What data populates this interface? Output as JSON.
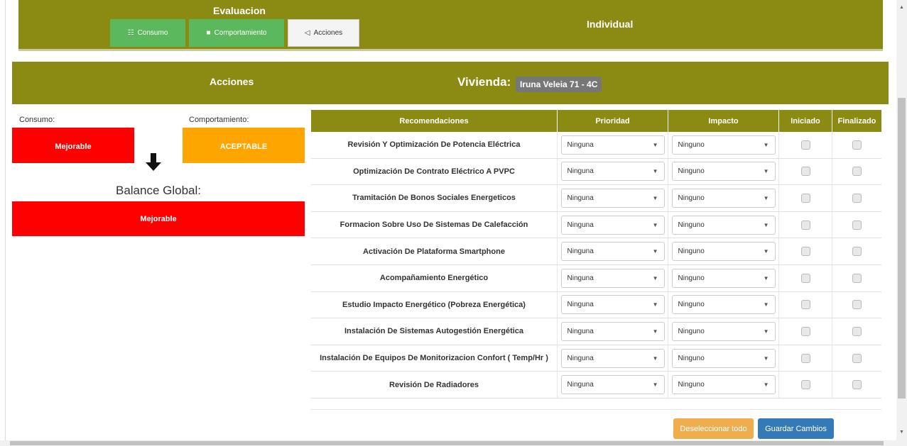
{
  "header": {
    "eval_title": "Evaluacion",
    "individual_title": "Individual",
    "tabs": [
      {
        "label": "Consumo",
        "icon": "chart-icon"
      },
      {
        "label": "Comportamiento",
        "icon": "book-icon"
      },
      {
        "label": "Acciones",
        "icon": "megaphone-icon"
      }
    ]
  },
  "acciones_bar": {
    "title": "Acciones",
    "vivienda_label": "Vivienda:",
    "vivienda_value": "Iruna Veleia 71 - 4C"
  },
  "left": {
    "consumo_label": "Consumo:",
    "consumo_value": "Mejorable",
    "comportamiento_label": "Comportamiento:",
    "comportamiento_value": "ACEPTABLE",
    "balance_title": "Balance Global:",
    "balance_value": "Mejorable"
  },
  "table": {
    "headers": [
      "Recomendaciones",
      "Prioridad",
      "Impacto",
      "Iniciado",
      "Finalizado"
    ],
    "rows": [
      {
        "name": "Revisión Y Optimización De Potencia Eléctrica",
        "prioridad": "Ninguna",
        "impacto": "Ninguno"
      },
      {
        "name": "Optimización De Contrato Eléctrico A PVPC",
        "prioridad": "Ninguna",
        "impacto": "Ninguno"
      },
      {
        "name": "Tramitación De Bonos Sociales Energeticos",
        "prioridad": "Ninguna",
        "impacto": "Ninguno"
      },
      {
        "name": "Formacion Sobre Uso De Sistemas De Calefacción",
        "prioridad": "Ninguna",
        "impacto": "Ninguno"
      },
      {
        "name": "Activación De Plataforma Smartphone",
        "prioridad": "Ninguna",
        "impacto": "Ninguno"
      },
      {
        "name": "Acompañamiento Energético",
        "prioridad": "Ninguna",
        "impacto": "Ninguno"
      },
      {
        "name": "Estudio Impacto Energético (Pobreza Energética)",
        "prioridad": "Ninguna",
        "impacto": "Ninguno"
      },
      {
        "name": "Instalación De Sistemas Autogestión Energética",
        "prioridad": "Ninguna",
        "impacto": "Ninguno"
      },
      {
        "name": "Instalación De Equipos De Monitorizacion Confort ( Temp/Hr )",
        "prioridad": "Ninguna",
        "impacto": "Ninguno"
      },
      {
        "name": "Revisión De Radiadores",
        "prioridad": "Ninguna",
        "impacto": "Ninguno"
      }
    ]
  },
  "buttons": {
    "deselect": "Deseleccionar todo",
    "save": "Guardar Cambios"
  },
  "colors": {
    "olive": "#8b8b14",
    "red": "#ff0000",
    "orange": "#ffa500",
    "green": "#5cb85c",
    "blue": "#337ab7",
    "warning": "#f0ad4e"
  }
}
